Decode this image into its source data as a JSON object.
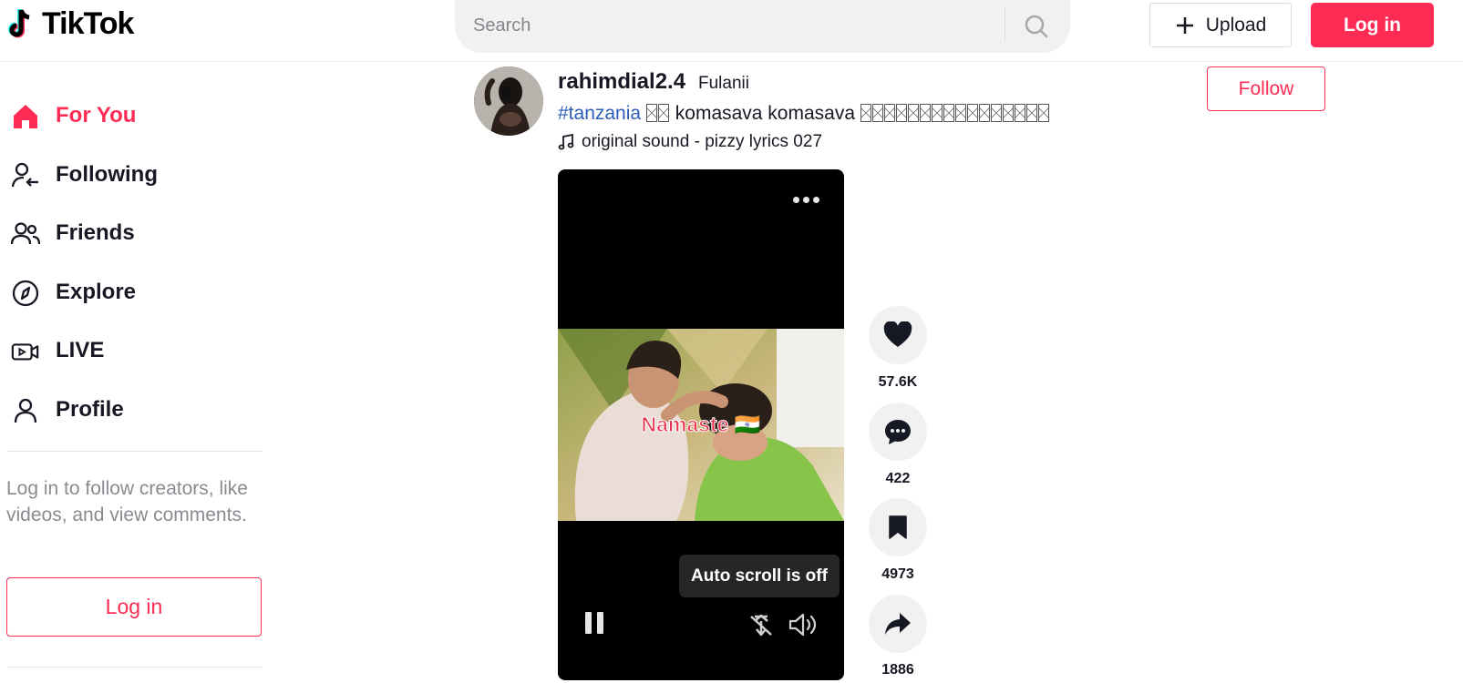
{
  "header": {
    "logo_text": "TikTok",
    "search_placeholder": "Search",
    "upload_label": "Upload",
    "login_label": "Log in"
  },
  "sidebar": {
    "items": [
      {
        "label": "For You",
        "icon": "home-icon",
        "active": true
      },
      {
        "label": "Following",
        "icon": "following-icon",
        "active": false
      },
      {
        "label": "Friends",
        "icon": "friends-icon",
        "active": false
      },
      {
        "label": "Explore",
        "icon": "compass-icon",
        "active": false
      },
      {
        "label": "LIVE",
        "icon": "live-icon",
        "active": false
      },
      {
        "label": "Profile",
        "icon": "profile-icon",
        "active": false
      }
    ],
    "login_prompt": "Log in to follow creators, like videos, and view comments.",
    "login_button": "Log in"
  },
  "post": {
    "username": "rahimdial2.4",
    "nickname": "Fulanii",
    "hashtag": "#tanzania",
    "caption_text": "komasava komasava",
    "sound": "original sound - pizzy lyrics 027",
    "follow_label": "Follow",
    "video_overlay_text": "Namaste 🇮🇳",
    "toast": "Auto scroll is off",
    "actions": {
      "likes": "57.6K",
      "comments": "422",
      "saves": "4973",
      "shares": "1886"
    }
  },
  "colors": {
    "brand": "#fe2c55",
    "hashtag": "#2b5db9",
    "text": "#161823",
    "muted": "#8a8b91"
  }
}
